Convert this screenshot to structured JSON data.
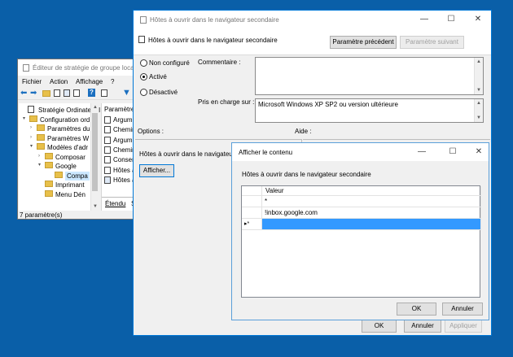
{
  "gpedit": {
    "title": "Éditeur de stratégie de groupe locale",
    "menu": [
      "Fichier",
      "Action",
      "Affichage",
      "?"
    ],
    "tree": [
      {
        "label": "Stratégie Ordinateur l",
        "twisty": ""
      },
      {
        "label": "Configuration ord",
        "twisty": "▾"
      },
      {
        "label": "Paramètres du",
        "twisty": "›"
      },
      {
        "label": "Paramètres W",
        "twisty": "›"
      },
      {
        "label": "Modèles d'adr",
        "twisty": "▾"
      },
      {
        "label": "Composar",
        "twisty": "›"
      },
      {
        "label": "Google",
        "twisty": "▾"
      },
      {
        "label": "Compa",
        "twisty": ""
      },
      {
        "label": "Imprimant",
        "twisty": ""
      },
      {
        "label": "Menu Dén",
        "twisty": ""
      }
    ],
    "list_header": "Paramètre",
    "list_items": [
      "Argume",
      "Chemin",
      "Argume",
      "Chemin",
      "Conserv",
      "Hôtes à",
      "Hôtes à"
    ],
    "tabs": [
      "Étendu",
      "S"
    ],
    "status": "7 paramètre(s)"
  },
  "policy": {
    "title": "Hôtes à ouvrir dans le navigateur secondaire",
    "heading": "Hôtes à ouvrir dans le navigateur secondaire",
    "prev_button": "Paramètre précédent",
    "next_button": "Paramètre suivant",
    "options": {
      "not_configured": "Non configuré",
      "enabled": "Activé",
      "disabled": "Désactivé",
      "selected": "enabled"
    },
    "comment_label": "Commentaire :",
    "supported_label": "Pris en charge sur :",
    "supported_value": "Microsoft Windows XP SP2 ou version ultérieure",
    "options_label": "Options :",
    "help_label": "Aide :",
    "options_text": "Hôtes à ouvrir dans le navigateur se",
    "show_button": "Afficher...",
    "ok_button": "OK",
    "cancel_button": "Annuler",
    "apply_button": "Appliquer"
  },
  "show_contents": {
    "title": "Afficher le contenu",
    "heading": "Hôtes à ouvrir dans le navigateur secondaire",
    "column": "Valeur",
    "rows": [
      {
        "marker": "",
        "value": "*"
      },
      {
        "marker": "",
        "value": "!inbox.google.com"
      },
      {
        "marker": "▸*",
        "value": ""
      }
    ],
    "ok_button": "OK",
    "cancel_button": "Annuler"
  },
  "colors": {
    "desktop": "#0a5fa8",
    "selection": "#3399ff",
    "accent_border": "#0078d7"
  }
}
